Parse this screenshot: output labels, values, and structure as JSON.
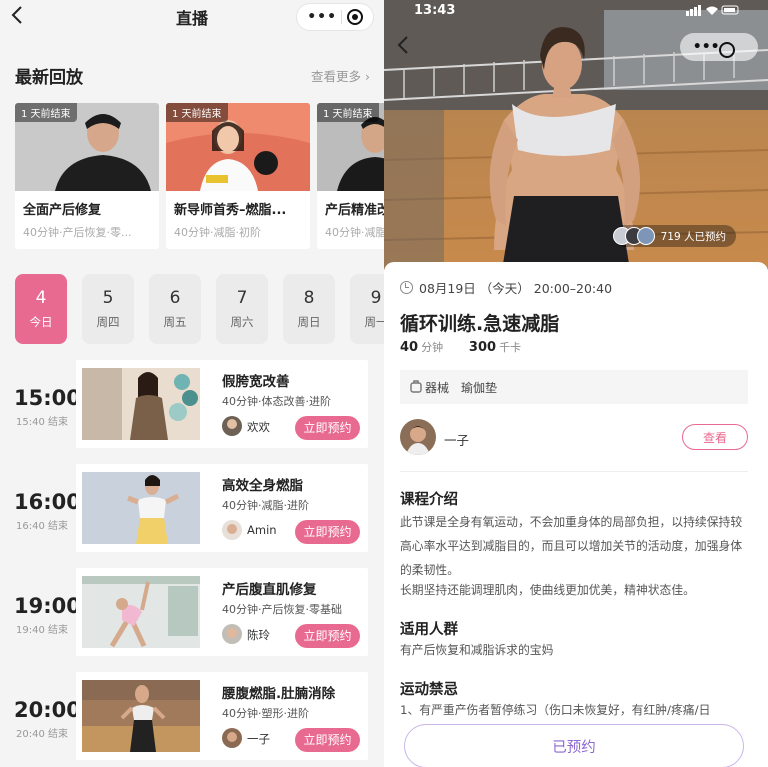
{
  "left": {
    "header": {
      "title": "直播"
    },
    "replays": {
      "title": "最新回放",
      "more": "查看更多",
      "items": [
        {
          "badge": "1 天前结束",
          "name": "全面产后修复",
          "meta": "40分钟·产后恢复·零..."
        },
        {
          "badge": "1 天前结束",
          "name": "新导师首秀–燃脂...",
          "meta": "40分钟·减脂·初阶"
        },
        {
          "badge": "1 天前结束",
          "name": "产后精准改...",
          "meta": "40分钟·减脂"
        }
      ]
    },
    "dates": [
      {
        "day": "4",
        "week": "今日",
        "active": true
      },
      {
        "day": "5",
        "week": "周四"
      },
      {
        "day": "6",
        "week": "周五"
      },
      {
        "day": "7",
        "week": "周六"
      },
      {
        "day": "8",
        "week": "周日"
      },
      {
        "day": "9",
        "week": "周一"
      }
    ],
    "schedule": [
      {
        "time": "15:00",
        "end": "15:40 结束",
        "name": "假胯宽改善",
        "meta": "40分钟·体态改善·进阶",
        "coach": "欢欢",
        "action": "立即预约"
      },
      {
        "time": "16:00",
        "end": "16:40 结束",
        "name": "高效全身燃脂",
        "meta": "40分钟·减脂·进阶",
        "coach": "Amin",
        "action": "立即预约"
      },
      {
        "time": "19:00",
        "end": "19:40 结束",
        "name": "产后腹直肌修复",
        "meta": "40分钟·产后恢复·零基础",
        "coach": "陈玲",
        "action": "立即预约"
      },
      {
        "time": "20:00",
        "end": "20:40 结束",
        "name": "腰腹燃脂.肚腩消除",
        "meta": "40分钟·塑形·进阶",
        "coach": "一子",
        "action": "立即预约"
      }
    ]
  },
  "right": {
    "status": {
      "time": "13:43"
    },
    "booked_count": "719 人已预约",
    "when": "08月19日 （今天） 20:00–20:40",
    "title": "循环训练.急速减脂",
    "minutes": "40",
    "minutes_unit": "分钟",
    "kcal": "300",
    "kcal_unit": "千卡",
    "equipment_label": "器械",
    "equipment": "瑜伽垫",
    "coach": "一子",
    "view_label": "查看",
    "intro_title": "课程介绍",
    "intro_text": "此节课是全身有氧运动，不会加重身体的局部负担，以持续保持较高心率水平达到减脂目的，而且可以增加关节的活动度，加强身体的柔韧性。",
    "intro_text2": "长期坚持还能调理肌肉，使曲线更加优美，精神状态佳。",
    "audience_title": "适用人群",
    "audience_text": "有产后恢复和减脂诉求的宝妈",
    "contra_title": "运动禁忌",
    "contra_text": "1、有严重产伤者暂停练习（伤口未恢复好，有红肿/疼痛/日",
    "reserved_label": "已预约",
    "accent_pink": "#e96a90"
  }
}
